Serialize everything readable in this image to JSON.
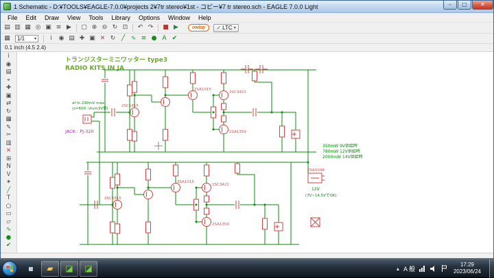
{
  "window": {
    "title": "1 Schematic - D:¥TOOLS¥EAGLE-7.0.0¥projects 2¥7tr stereo¥1st - コピー¥7 tr stereo.sch - EAGLE 7.0.0 Light",
    "controls": [
      {
        "name": "minimize-button",
        "glyph": "–"
      },
      {
        "name": "maximize-button",
        "glyph": "▢"
      },
      {
        "name": "close-button",
        "glyph": "✕"
      }
    ]
  },
  "menubar": {
    "items": [
      {
        "name": "menu-file",
        "label": "File"
      },
      {
        "name": "menu-edit",
        "label": "Edit"
      },
      {
        "name": "menu-draw",
        "label": "Draw"
      },
      {
        "name": "menu-view",
        "label": "View"
      },
      {
        "name": "menu-tools",
        "label": "Tools"
      },
      {
        "name": "menu-library",
        "label": "Library"
      },
      {
        "name": "menu-options",
        "label": "Options"
      },
      {
        "name": "menu-window",
        "label": "Window"
      },
      {
        "name": "menu-help",
        "label": "Help"
      }
    ]
  },
  "toolbar_main": {
    "file_icons": [
      {
        "name": "open-icon",
        "glyph": "▤"
      },
      {
        "name": "save-icon",
        "glyph": "▥"
      },
      {
        "name": "print-icon",
        "glyph": "▦"
      },
      {
        "name": "cam-icon",
        "glyph": "◎"
      },
      {
        "name": "sheet-icon",
        "glyph": "▣"
      },
      {
        "name": "script-icon",
        "glyph": "≡"
      },
      {
        "name": "run-ulp-icon",
        "glyph": "▶"
      }
    ],
    "zoom_icons": [
      {
        "name": "zoom-fit-icon",
        "glyph": "▢"
      },
      {
        "name": "zoom-in-icon",
        "glyph": "⊕"
      },
      {
        "name": "zoom-out-icon",
        "glyph": "⊖"
      },
      {
        "name": "zoom-redraw-icon",
        "glyph": "↻"
      },
      {
        "name": "zoom-select-icon",
        "glyph": "⊡"
      }
    ],
    "history_icons": [
      {
        "name": "undo-icon",
        "glyph": "↶"
      },
      {
        "name": "redo-icon",
        "glyph": "↷"
      }
    ],
    "run_icons": [
      {
        "name": "stop-icon",
        "glyph": "■",
        "color": "#b03a2e"
      },
      {
        "name": "go-icon",
        "glyph": "▶",
        "color": "#1e8449"
      }
    ],
    "owlay_label": "owlay",
    "ltc": {
      "check": "✓",
      "label": "LTC",
      "arrow": "▾"
    }
  },
  "toolbar_second": {
    "left_icons": [
      {
        "name": "grid-icon",
        "glyph": "▦"
      }
    ],
    "sheet_value": "1/1",
    "sheet_arrow": "▾",
    "right_icons": [
      {
        "name": "info-icon",
        "glyph": "i"
      },
      {
        "name": "show-icon",
        "glyph": "◉"
      },
      {
        "name": "display-icon",
        "glyph": "▤"
      },
      {
        "name": "move-icon",
        "glyph": "✚"
      },
      {
        "name": "copy-icon",
        "glyph": "▣"
      },
      {
        "name": "delete-icon",
        "glyph": "✕",
        "color": "#c0392b"
      },
      {
        "name": "rotate-icon",
        "glyph": "↻"
      },
      {
        "name": "wire-icon",
        "glyph": "╱",
        "color": "#148f14"
      },
      {
        "name": "net-icon",
        "glyph": "∿",
        "color": "#148f14"
      },
      {
        "name": "bus-icon",
        "glyph": "≡",
        "color": "#148f14"
      },
      {
        "name": "junction-icon",
        "glyph": "●",
        "color": "#148f14"
      },
      {
        "name": "label-icon",
        "glyph": "A",
        "color": "#148f14"
      },
      {
        "name": "erc-icon",
        "glyph": "✔",
        "color": "#148f14"
      }
    ]
  },
  "coordbar": {
    "text": "0.1 inch (4.5 2.4)"
  },
  "left_toolbar": {
    "tools": [
      {
        "name": "info-tool",
        "glyph": "i"
      },
      {
        "name": "show-tool",
        "glyph": "◉"
      },
      {
        "name": "display-tool",
        "glyph": "▤"
      },
      {
        "name": "mark-tool",
        "glyph": "⌖"
      },
      {
        "name": "move-tool",
        "glyph": "✚"
      },
      {
        "name": "copy-tool",
        "glyph": "▣"
      },
      {
        "name": "mirror-tool",
        "glyph": "⇄"
      },
      {
        "name": "rotate-tool",
        "glyph": "↻"
      },
      {
        "name": "group-tool",
        "glyph": "▦"
      },
      {
        "name": "change-tool",
        "glyph": "✎"
      },
      {
        "name": "cut-tool",
        "glyph": "✂"
      },
      {
        "name": "paste-tool",
        "glyph": "▥"
      },
      {
        "name": "delete-tool",
        "glyph": "✕",
        "color": "#c0392b"
      },
      {
        "name": "add-tool",
        "glyph": "⊞"
      },
      {
        "name": "name-tool",
        "glyph": "N"
      },
      {
        "name": "value-tool",
        "glyph": "V"
      },
      {
        "name": "smash-tool",
        "glyph": "✶"
      },
      {
        "name": "wire-tool",
        "glyph": "╱",
        "color": "#148f14"
      },
      {
        "name": "text-tool",
        "glyph": "T"
      },
      {
        "name": "circle-tool",
        "glyph": "○"
      },
      {
        "name": "rect-tool",
        "glyph": "▭"
      },
      {
        "name": "polygon-tool",
        "glyph": "▱"
      },
      {
        "name": "net-tool",
        "glyph": "∿",
        "color": "#148f14"
      },
      {
        "name": "junction-tool",
        "glyph": "●",
        "color": "#148f14"
      },
      {
        "name": "erc-tool",
        "glyph": "✔",
        "color": "#148f14"
      }
    ]
  },
  "canvas": {
    "title_line1": "トランジスターミニワッター  type3",
    "title_line2": "RADIO KITS IN JA",
    "af_in_note": "af in  290mV max",
    "impedance_note": "(z=600 :vtvm3V振)",
    "jack_note": "JACK : PJ-320",
    "power_note1": "350mW   9V供給時",
    "power_note2": "780mW   12V供給時",
    "power_note3": "2000mW  14V供給時",
    "supply_label": "12V",
    "supply_range": "(7V~14.5VでOK)",
    "dc_jack_part": "2SA1048",
    "parts": {
      "npn_out": "2SC3422",
      "pnp_out": "2SA1359",
      "npn_in": "2SC1815",
      "pnp_drv": "2SA1015"
    }
  },
  "taskbar": {
    "show_hidden_glyph": "▴",
    "ime_label": "A 般",
    "clock": {
      "time": "17:29",
      "date": "2023/06/24"
    },
    "buttons": [
      {
        "name": "taskbar-app-button",
        "glyph": "▪",
        "color": "#c2cfdb",
        "active": false
      },
      {
        "name": "taskbar-explorer-button",
        "glyph": "▰",
        "color": "#f0c64f",
        "active": true
      },
      {
        "name": "taskbar-eagle-control-button",
        "glyph": "◪",
        "color": "#79d141",
        "active": true
      },
      {
        "name": "taskbar-eagle-schematic-button",
        "glyph": "◪",
        "color": "#79d141",
        "active": true
      }
    ]
  }
}
